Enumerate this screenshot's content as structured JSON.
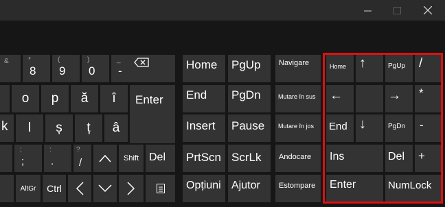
{
  "window": {
    "minimize_icon": "minimize-icon",
    "maximize_icon": "maximize-icon",
    "close_icon": "close-icon"
  },
  "keys": {
    "k8": {
      "main": "8",
      "sub": "*"
    },
    "k9": {
      "main": "9",
      "sub": "("
    },
    "k0": {
      "main": "0",
      "sub": ")"
    },
    "minus": {
      "main": "-",
      "sub": "_"
    },
    "equals": {
      "main": "=",
      "sub": "+"
    },
    "backspace_icon": "backspace-icon",
    "o": "o",
    "p": "p",
    "abreve": "ă",
    "icirc": "î",
    "enter": "Enter",
    "k": "k",
    "l": "l",
    "scomma": "ș",
    "tcomma": "ț",
    "acirc": "â",
    "semicolon": {
      "main": ";",
      "sub": ";"
    },
    "period": {
      "main": ".",
      "sub": ":"
    },
    "slash": {
      "main": "/",
      "sub": "?"
    },
    "up_icon": "up-arrow-icon",
    "shift": "Shift",
    "del": "Del",
    "altgr": "AltGr",
    "ctrl": "Ctrl",
    "left_icon": "left-arrow-icon",
    "down_icon": "down-arrow-icon",
    "right_icon": "right-arrow-icon",
    "menu_icon": "menu-icon"
  },
  "nav": {
    "home": "Home",
    "pgup": "PgUp",
    "end": "End",
    "pgdn": "PgDn",
    "insert": "Insert",
    "pause": "Pause",
    "prtscn": "PrtScn",
    "scrlk": "ScrLk",
    "optiuni": "Opțiuni",
    "ajutor": "Ajutor"
  },
  "side": {
    "navigare": "Navigare",
    "mutare_sus": "Mutare în sus",
    "mutare_jos": "Mutare în jos",
    "andocare": "Andocare",
    "estompare": "Estompare"
  },
  "numpad": {
    "home": "Home",
    "up": "↑",
    "pgup": "PgUp",
    "divide": "/",
    "left": "←",
    "right": "→",
    "multiply": "*",
    "end": "End",
    "down": "↓",
    "pgdn": "PgDn",
    "subtract": "-",
    "ins": "Ins",
    "del": "Del",
    "add": "+",
    "enter": "Enter",
    "numlock": "NumLock"
  },
  "colors": {
    "highlight": "#e01010",
    "key": "#333333",
    "background": "#161616"
  }
}
